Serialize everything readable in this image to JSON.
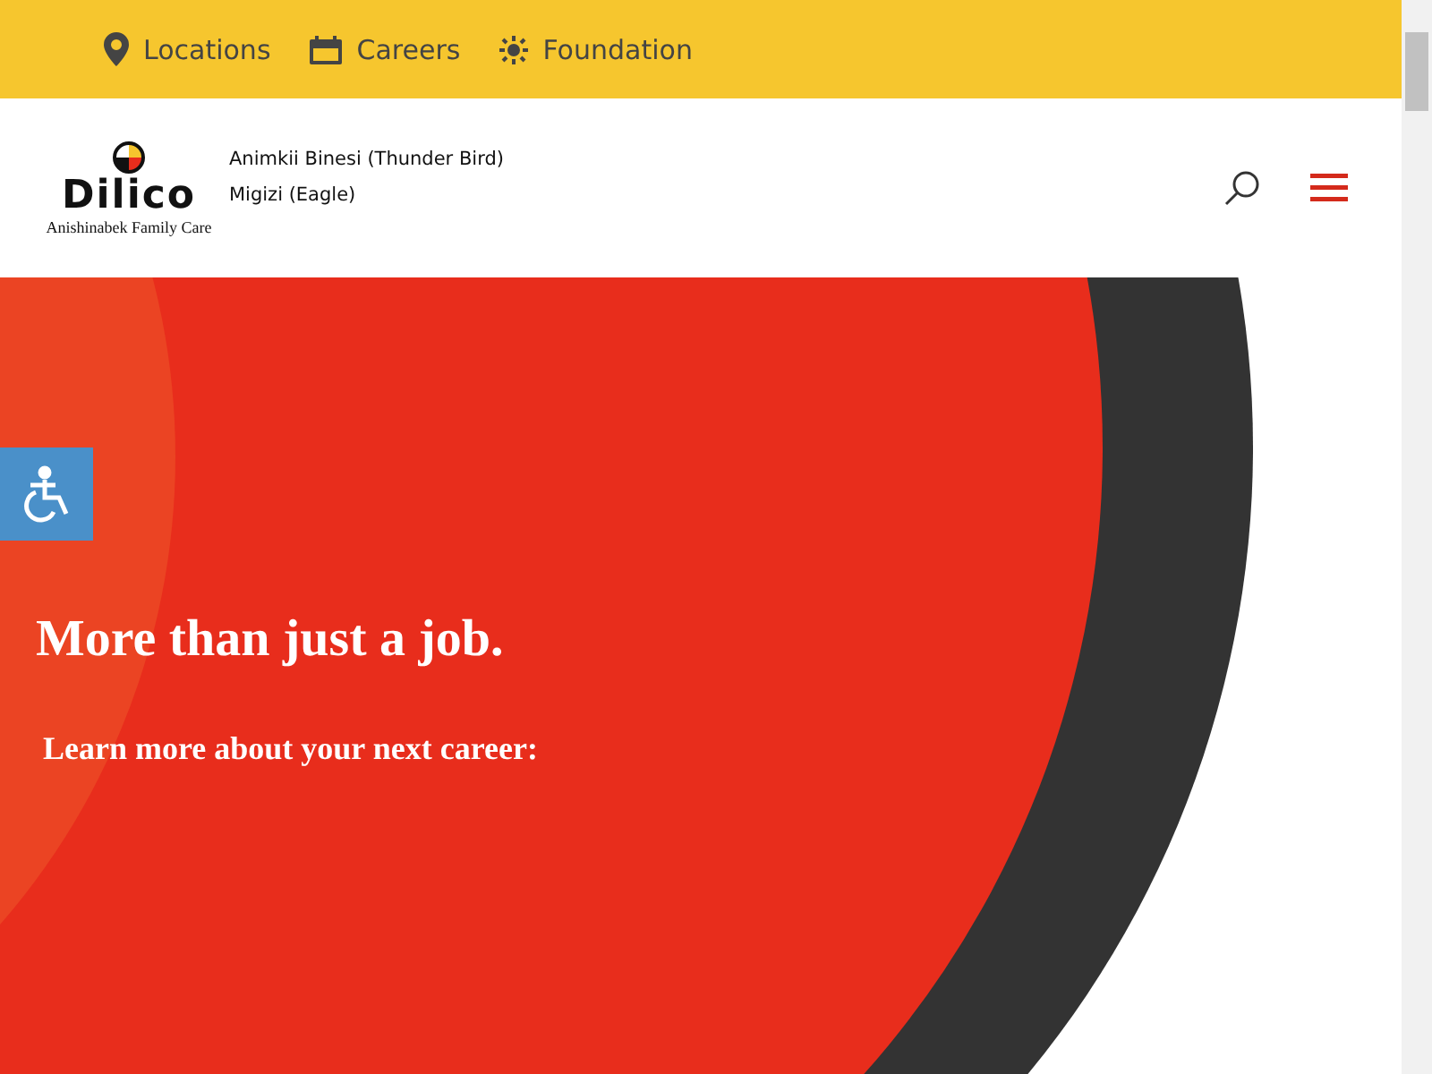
{
  "top_bar": {
    "links": [
      {
        "label": "Locations",
        "kind": "pin"
      },
      {
        "label": "Careers",
        "kind": "calendar"
      },
      {
        "label": "Foundation",
        "kind": "sun"
      }
    ]
  },
  "header": {
    "logo": {
      "name": "Dilico",
      "tagline": "Anishinabek Family Care"
    },
    "nav": [
      "Animkii Binesi (Thunder Bird)",
      "Migizi (Eagle)"
    ]
  },
  "hero": {
    "title": "More than just a job.",
    "subtitle": "Learn more about your next career:"
  }
}
